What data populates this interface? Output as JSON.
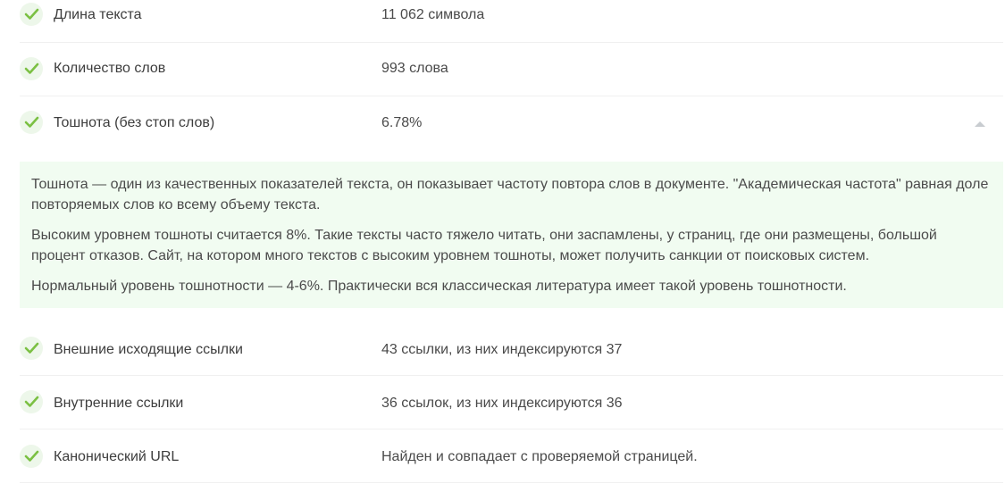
{
  "checks_top": [
    {
      "label": "Длина текста",
      "value": "11 062 символа"
    },
    {
      "label": "Количество слов",
      "value": "993 слова"
    },
    {
      "label": "Тошнота (без стоп слов)",
      "value": "6.78%"
    }
  ],
  "info": {
    "paragraphs": [
      "Тошнота — один из качественных показателей текста, он показывает частоту повтора слов в документе. \"Академическая частота\" равная доле повторяемых слов ко всему объему текста.",
      "Высоким уровнем тошноты считается 8%. Такие тексты часто тяжело читать, они заспамлены, у страниц, где они размещены, большой процент отказов. Сайт, на котором много текстов с высоким уровнем тошноты, может получить санкции от поисковых систем.",
      "Нормальный уровень тошнотности — 4-6%. Практически вся классическая литература имеет такой уровень тошнотности."
    ]
  },
  "checks_bottom": [
    {
      "label": "Внешние исходящие ссылки",
      "value": "43 ссылки, из них индексируются 37"
    },
    {
      "label": "Внутренние ссылки",
      "value": "36 ссылок, из них индексируются 36"
    },
    {
      "label": "Канонический URL",
      "value": "Найден и совпадает с проверяемой страницей."
    }
  ],
  "icons": {
    "status": "check-icon",
    "toggle": "chevron-up-icon"
  },
  "colors": {
    "check": "#7bc043",
    "badge_bg": "#edf7ea",
    "panel_bg": "#f1fcf1",
    "text": "#3d3d3d",
    "toggle": "#c8ccd0"
  }
}
